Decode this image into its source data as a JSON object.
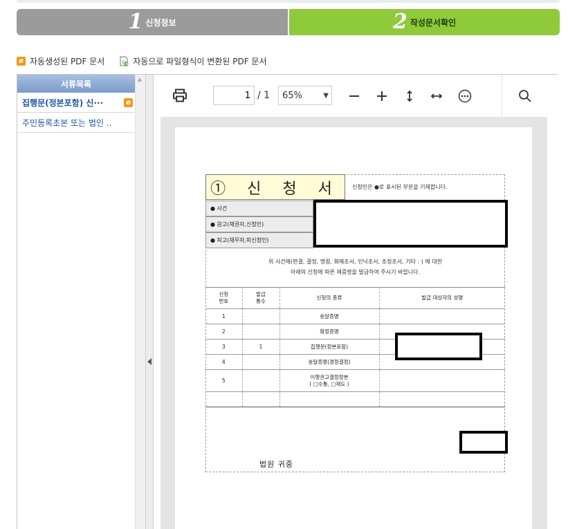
{
  "steps": [
    {
      "number": "1",
      "label": "신청정보"
    },
    {
      "number": "2",
      "label": "작성문서확인"
    }
  ],
  "legend": {
    "auto_pdf": "자동생성된 PDF 문서",
    "converted_pdf": "자동으로 파일형식이 변환된 PDF 문서"
  },
  "doclist": {
    "header": "서류목록",
    "items": [
      {
        "label": "집행문(정본포함) 신···",
        "icon": "e-doc-icon"
      },
      {
        "label": "주민등록초본 또는 법인 .."
      }
    ]
  },
  "viewer": {
    "page_current": "1",
    "page_total": "/ 1",
    "zoom": "65%"
  },
  "form": {
    "title": "① 신 청 서",
    "hint": "신청인은 ●로 표시된 부분을 기재합니다.",
    "fields": [
      "● 사건",
      "● 원고(채권자,신청인)",
      "● 피고(채무자,피신청인)"
    ],
    "note_line1": "위 사건에(판결, 결정, 명령, 화해조서, 인낙조서, 조정조서, 기타 :                    ) 에 대한",
    "note_line2": "아래의 신청에 따른 제증명을 발급하여 주시기 바랍니다.",
    "table_headers": [
      "신청\n번호",
      "발급\n통수",
      "신청의 종류",
      "발급 대상자의 성명"
    ],
    "rows": [
      {
        "no": "1",
        "count": "",
        "kind": "송달증명"
      },
      {
        "no": "2",
        "count": "",
        "kind": "확정증명"
      },
      {
        "no": "3",
        "count": "1",
        "kind": "집행문(정본포함)"
      },
      {
        "no": "4",
        "count": "",
        "kind": "송달증명(경정결정)"
      },
      {
        "no": "5",
        "count": "",
        "kind": "이행권고결정정본\n( □수통, □재도 )"
      }
    ],
    "court": "법원  귀중"
  }
}
